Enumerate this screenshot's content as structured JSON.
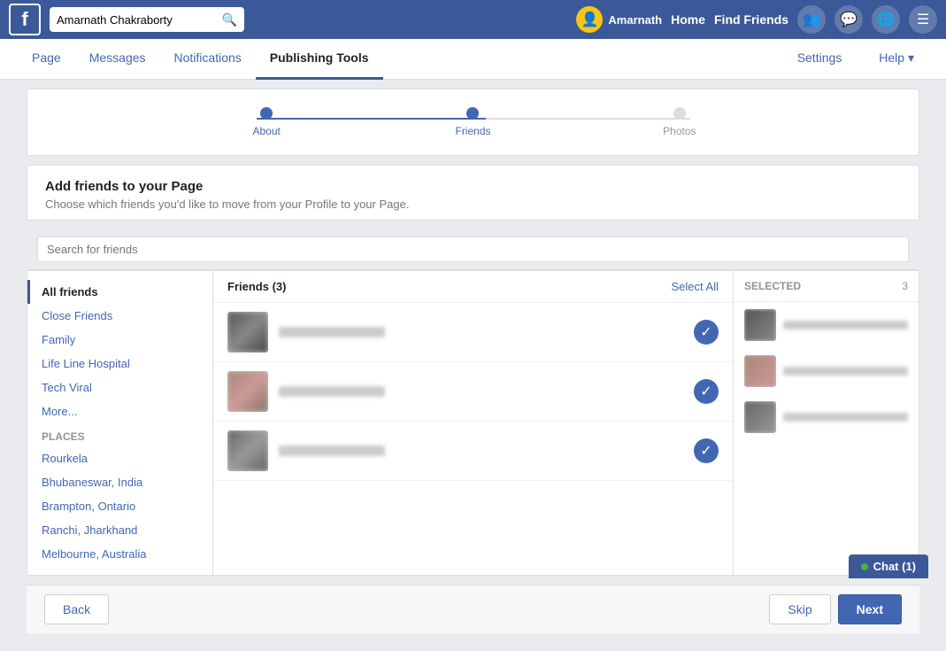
{
  "topNav": {
    "logoText": "f",
    "searchPlaceholder": "Amarnath Chakraborty",
    "userName": "Amarnath",
    "homeLabel": "Home",
    "findFriendsLabel": "Find Friends"
  },
  "secNav": {
    "items": [
      {
        "label": "Page",
        "active": false
      },
      {
        "label": "Messages",
        "active": false
      },
      {
        "label": "Notifications",
        "active": false
      },
      {
        "label": "Publishing Tools",
        "active": true
      }
    ],
    "rightItems": [
      {
        "label": "Settings"
      },
      {
        "label": "Help ▾"
      }
    ]
  },
  "wizard": {
    "steps": [
      {
        "label": "About",
        "state": "done"
      },
      {
        "label": "Friends",
        "state": "active"
      },
      {
        "label": "Photos",
        "state": "gray"
      }
    ]
  },
  "addFriends": {
    "title": "Add friends to your Page",
    "description": "Choose which friends you'd like to move from your Profile to your Page."
  },
  "searchFriends": {
    "placeholder": "Search for friends"
  },
  "leftPanel": {
    "items": [
      {
        "label": "All friends",
        "active": true
      },
      {
        "label": "Close Friends",
        "active": false
      },
      {
        "label": "Family",
        "active": false
      },
      {
        "label": "Life Line Hospital",
        "active": false
      },
      {
        "label": "Tech Viral",
        "active": false
      },
      {
        "label": "More...",
        "active": false
      }
    ],
    "placesSection": "Places",
    "places": [
      {
        "label": "Rourkela"
      },
      {
        "label": "Bhubaneswar, India"
      },
      {
        "label": "Brampton, Ontario"
      },
      {
        "label": "Ranchi, Jharkhand"
      },
      {
        "label": "Melbourne, Australia"
      }
    ]
  },
  "centerPanel": {
    "friendsCount": "Friends (3)",
    "selectAllLabel": "Select All",
    "friends": [
      {
        "id": 1,
        "checked": true
      },
      {
        "id": 2,
        "checked": true
      },
      {
        "id": 3,
        "checked": true
      }
    ]
  },
  "rightPanel": {
    "selectedLabel": "SELECTED",
    "selectedCount": "3",
    "items": [
      {
        "id": 1
      },
      {
        "id": 2
      },
      {
        "id": 3
      }
    ]
  },
  "bottomBar": {
    "backLabel": "Back",
    "skipLabel": "Skip",
    "nextLabel": "Next"
  },
  "chat": {
    "label": "Chat (1)"
  }
}
